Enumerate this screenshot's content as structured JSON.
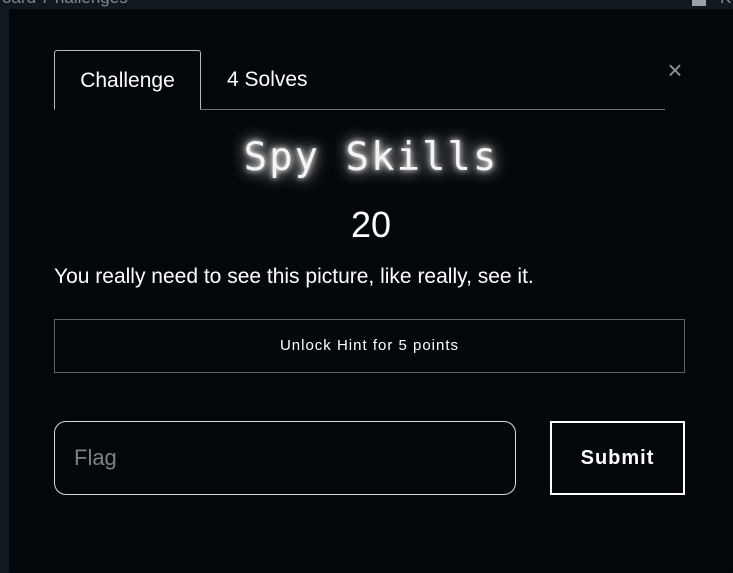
{
  "background_page": {
    "nav_left_text": "oard    7 hallenges",
    "nav_right_text": "K"
  },
  "modal": {
    "close_label": "×",
    "tabs": [
      {
        "label": "Challenge"
      },
      {
        "label": "4 Solves"
      }
    ],
    "challenge": {
      "name": "Spy Skills",
      "value": "20",
      "description": "You really need to see this picture, like really, see it."
    },
    "hint_button_label": "Unlock Hint for 5 points",
    "flag_input": {
      "value": "",
      "placeholder": "Flag"
    },
    "submit_label": "Submit"
  },
  "colors": {
    "modal_background": "#03070b",
    "text": "#ffffff",
    "placeholder": "#7b8288"
  }
}
